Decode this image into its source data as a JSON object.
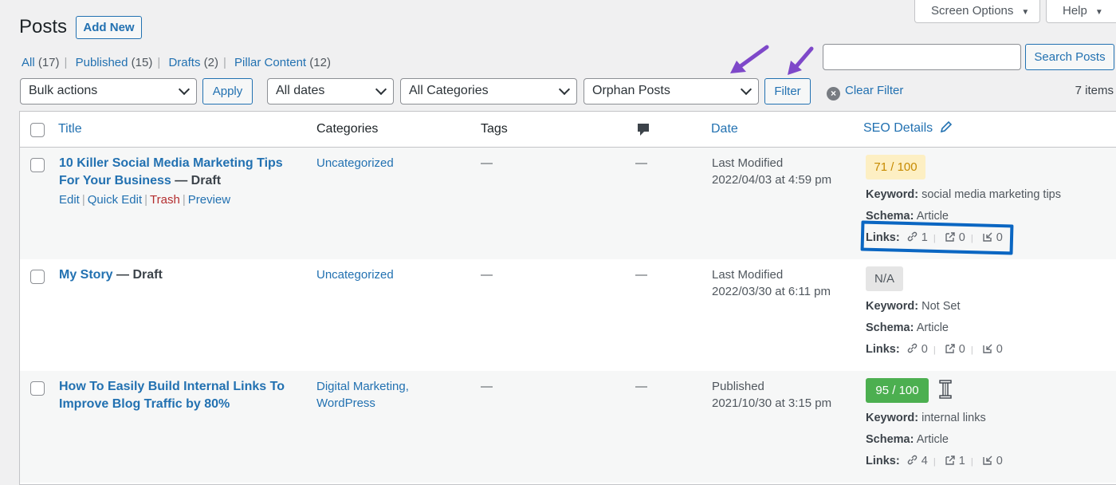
{
  "header": {
    "title": "Posts",
    "add_new": "Add New",
    "screen_options": "Screen Options",
    "help": "Help"
  },
  "views": [
    {
      "label": "All",
      "count": "(17)"
    },
    {
      "label": "Published",
      "count": "(15)"
    },
    {
      "label": "Drafts",
      "count": "(2)"
    },
    {
      "label": "Pillar Content",
      "count": "(12)"
    }
  ],
  "search": {
    "value": "",
    "button": "Search Posts"
  },
  "filters": {
    "bulk_actions": "Bulk actions",
    "apply": "Apply",
    "dates": "All dates",
    "categories": "All Categories",
    "orphan": "Orphan Posts",
    "filter": "Filter",
    "clear_filter": "Clear Filter",
    "items": "7 items"
  },
  "columns": {
    "title": "Title",
    "categories": "Categories",
    "tags": "Tags",
    "date": "Date",
    "seo": "SEO Details"
  },
  "seo_labels": {
    "keyword": "Keyword:",
    "schema": "Schema:",
    "links": "Links:"
  },
  "colors": {
    "accent": "#2271b1",
    "score_yellow_bg": "#fdefc3",
    "score_yellow_text": "#c68a00",
    "score_green": "#4caf50",
    "score_na_bg": "#e5e5e5",
    "purple_arrow": "#7e48c9",
    "highlight": "#0a66c2"
  },
  "rows": [
    {
      "title": "10 Killer Social Media Marketing Tips For Your Business",
      "state": "— Draft",
      "actions": [
        "Edit",
        "Quick Edit",
        "Trash",
        "Preview"
      ],
      "category": "Uncategorized",
      "tags": "—",
      "comments": "—",
      "date_status": "Last Modified",
      "date": "2022/04/03 at 4:59 pm",
      "score": "71 / 100",
      "keyword": "social media marketing tips",
      "schema": "Article",
      "links_internal": "1",
      "links_external": "0",
      "links_incoming": "0"
    },
    {
      "title": "My Story",
      "state": "— Draft",
      "category": "Uncategorized",
      "tags": "—",
      "comments": "—",
      "date_status": "Last Modified",
      "date": "2022/03/30 at 6:11 pm",
      "score": "N/A",
      "keyword": "Not Set",
      "schema": "Article",
      "links_internal": "0",
      "links_external": "0",
      "links_incoming": "0"
    },
    {
      "title": "How To Easily Build Internal Links To Improve Blog Traffic by 80%",
      "category": "Digital Marketing,",
      "category2": "WordPress",
      "tags": "—",
      "comments": "—",
      "date_status": "Published",
      "date": "2021/10/30 at 3:15 pm",
      "score": "95 / 100",
      "keyword": "internal links",
      "schema": "Article",
      "links_internal": "4",
      "links_external": "1",
      "links_incoming": "0"
    }
  ]
}
